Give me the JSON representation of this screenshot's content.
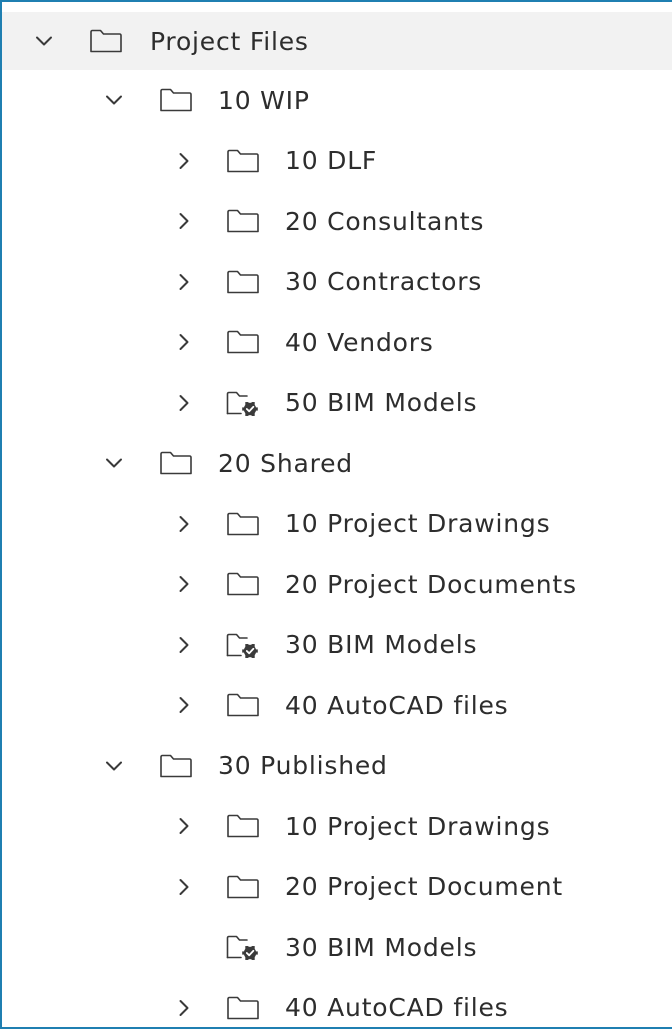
{
  "tree": {
    "root": {
      "label": "Project Files",
      "expanded": true,
      "icon": "folder-icon"
    },
    "groups": [
      {
        "label": "10 WIP",
        "expanded": true,
        "icon": "folder-icon",
        "children": [
          {
            "label": "10 DLF",
            "has_children": true,
            "icon": "folder-icon"
          },
          {
            "label": "20 Consultants",
            "has_children": true,
            "icon": "folder-icon"
          },
          {
            "label": "30 Contractors",
            "has_children": true,
            "icon": "folder-icon"
          },
          {
            "label": "40 Vendors",
            "has_children": true,
            "icon": "folder-icon"
          },
          {
            "label": "50 BIM Models",
            "has_children": true,
            "icon": "folder-settings-icon"
          }
        ]
      },
      {
        "label": "20 Shared",
        "expanded": true,
        "icon": "folder-icon",
        "children": [
          {
            "label": "10 Project Drawings",
            "has_children": true,
            "icon": "folder-icon"
          },
          {
            "label": "20 Project Documents",
            "has_children": true,
            "icon": "folder-icon"
          },
          {
            "label": "30 BIM Models",
            "has_children": true,
            "icon": "folder-settings-icon"
          },
          {
            "label": "40 AutoCAD files",
            "has_children": true,
            "icon": "folder-icon"
          }
        ]
      },
      {
        "label": "30 Published",
        "expanded": true,
        "icon": "folder-icon",
        "children": [
          {
            "label": "10 Project Drawings",
            "has_children": true,
            "icon": "folder-icon"
          },
          {
            "label": "20 Project Document",
            "has_children": true,
            "icon": "folder-icon"
          },
          {
            "label": "30 BIM Models",
            "has_children": false,
            "icon": "folder-settings-icon"
          },
          {
            "label": "40 AutoCAD files",
            "has_children": true,
            "icon": "folder-icon"
          }
        ]
      }
    ]
  },
  "colors": {
    "frame_border": "#1f7fb1",
    "root_row_bg": "#f2f2f2",
    "text": "#2d2d2d",
    "icon": "#3a3a3a"
  }
}
